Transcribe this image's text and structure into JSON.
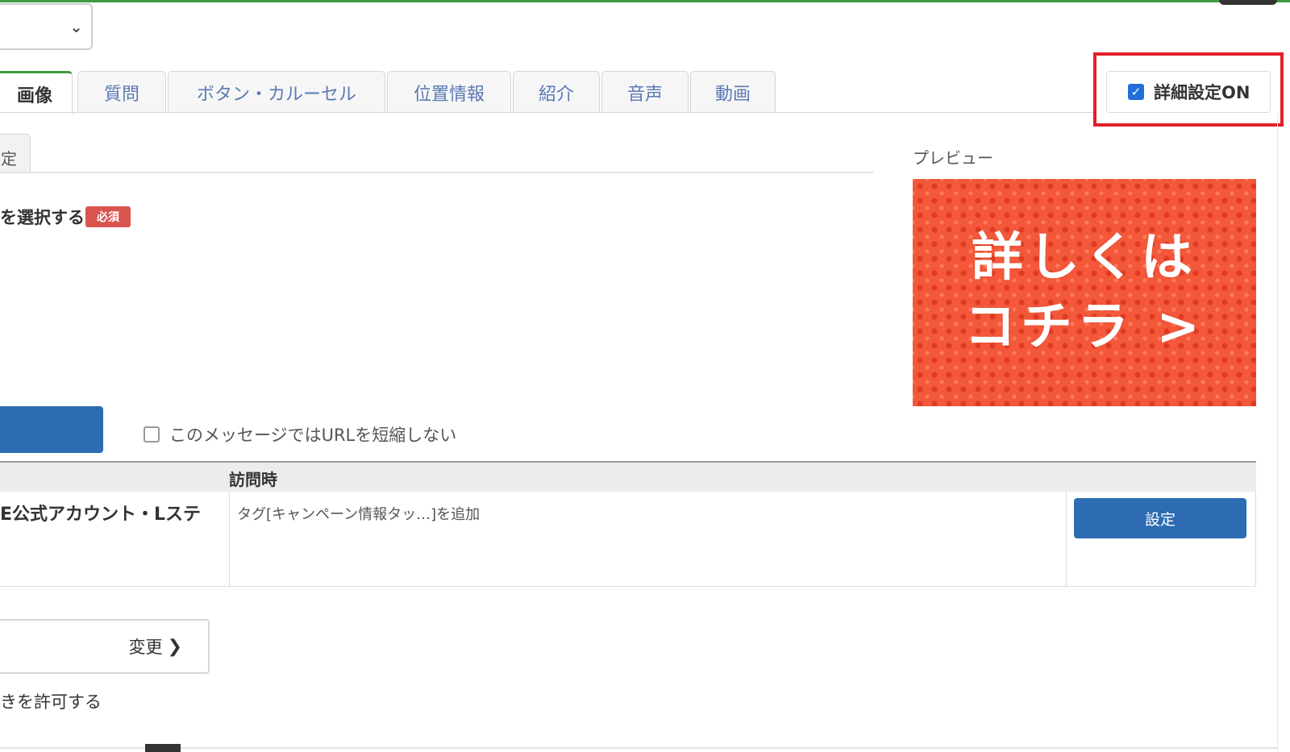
{
  "tabs": [
    {
      "label": "画像",
      "active": true
    },
    {
      "label": "質問",
      "active": false
    },
    {
      "label": "ボタン・カルーセル",
      "active": false
    },
    {
      "label": "位置情報",
      "active": false
    },
    {
      "label": "紹介",
      "active": false
    },
    {
      "label": "音声",
      "active": false
    },
    {
      "label": "動画",
      "active": false
    }
  ],
  "detail_setting": {
    "label": "詳細設定ON",
    "checked": true
  },
  "subtab": {
    "label": "定"
  },
  "image_section": {
    "label": "を選択する",
    "required_badge": "必須"
  },
  "preview": {
    "label": "プレビュー",
    "image_text_line1": "詳しくは",
    "image_text_line2": "コチラ >"
  },
  "short_url": {
    "label": "このメッセージではURLを短縮しない",
    "checked": false
  },
  "visit_table": {
    "header": "訪問時",
    "row_label": "E公式アカウント・Lステ",
    "row_action": "タグ[キャンペーン情報タッ…]を追加",
    "set_button": "設定"
  },
  "change_button": {
    "label": "変更",
    "arrow": "❯"
  },
  "allow_label": "きを許可する",
  "colors": {
    "accent_green": "#3f9a3f",
    "primary_blue": "#2d6cb3",
    "highlight_red": "#e0202a",
    "required_red": "#d9534f"
  }
}
